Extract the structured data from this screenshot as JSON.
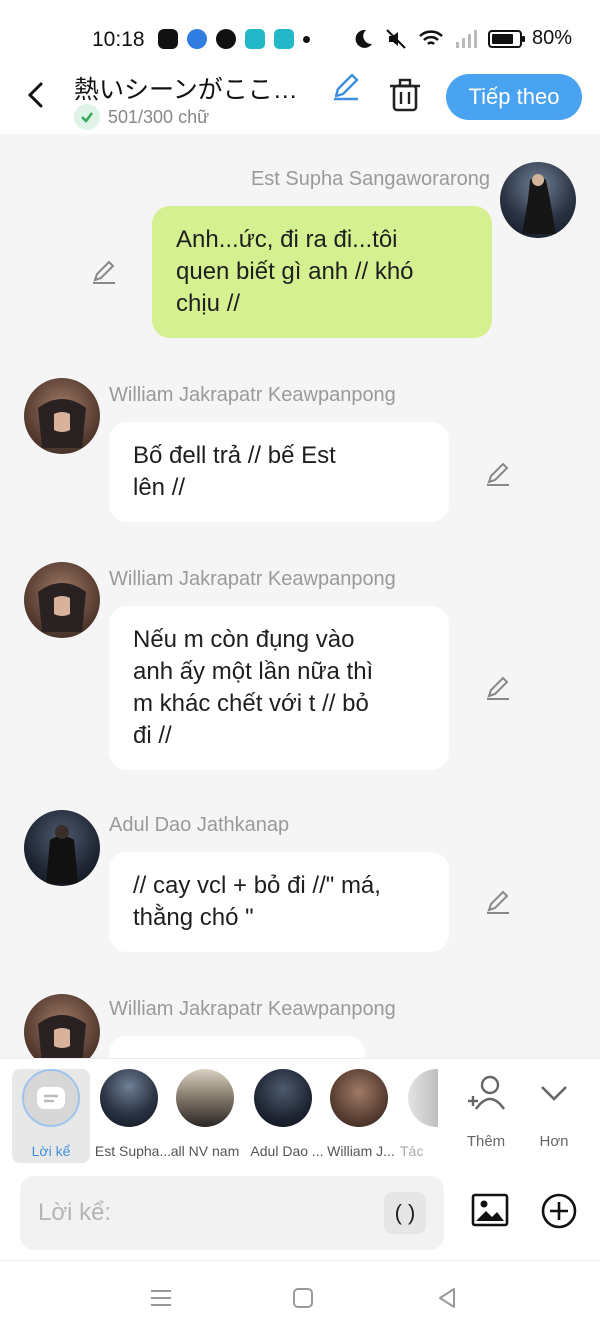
{
  "status_bar": {
    "time": "10:18",
    "battery_percent": "80%",
    "battery_level": 0.8
  },
  "header": {
    "title": "熱いシーンがここ…",
    "char_count": "501/300 chữ",
    "next_label": "Tiếp theo",
    "accent_color": "#4aa3f0"
  },
  "messages": [
    {
      "speaker": "Est Supha Sangaworarong",
      "text_lines": [
        "Anh...ức, đi ra đi...tôi",
        "quen biết gì anh // khó",
        "chịu //"
      ],
      "side": "right",
      "bubble_color": "#d5f090"
    },
    {
      "speaker": "William Jakrapatr Keawpanpong",
      "text_lines": [
        "Bố đell trả // bế Est",
        "lên //"
      ],
      "side": "left"
    },
    {
      "speaker": "William Jakrapatr Keawpanpong",
      "text_lines": [
        "Nếu m còn đụng vào",
        "anh ấy một lần nữa thì",
        "m khác chết với t // bỏ",
        "đi //"
      ],
      "side": "left"
    },
    {
      "speaker": "Adul Dao Jathkanap",
      "text_lines": [
        "// cay vcl + bỏ đi //\" má,",
        "thằng chó \""
      ],
      "side": "left"
    },
    {
      "speaker": "William Jakrapatr Keawpanpong",
      "text_lines": [],
      "side": "left"
    }
  ],
  "characters": {
    "narrator": "Lời kể",
    "list": [
      "Est Supha...",
      "all NV nam",
      "Adul Dao ...",
      "William J...",
      "Tác"
    ],
    "add_label": "Thêm",
    "more_label": "Hơn"
  },
  "composer": {
    "placeholder": "Lời kể:",
    "paren_label": "( )"
  }
}
